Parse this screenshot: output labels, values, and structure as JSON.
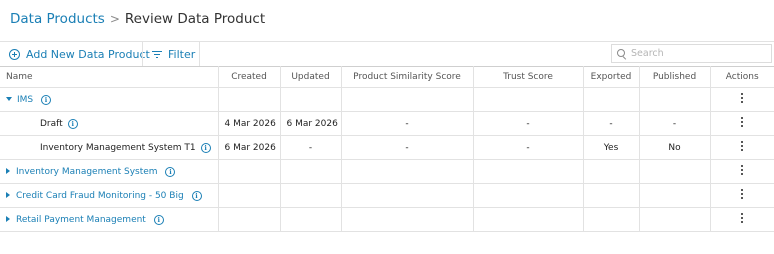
{
  "breadcrumb": {
    "parent": "Data Products",
    "separator": ">",
    "current": "Review Data Product"
  },
  "toolbar": {
    "add_label": "Add New Data Product",
    "filter_label": "Filter",
    "search_placeholder": "Search",
    "search_value": ""
  },
  "table": {
    "columns": [
      "Name",
      "Created",
      "Updated",
      "Product Similarity Score",
      "Trust Score",
      "Exported",
      "Published",
      "Actions"
    ],
    "rows": [
      {
        "type": "group",
        "expanded": true,
        "name": "IMS",
        "created": "",
        "updated": "",
        "similarity": "",
        "trust": "",
        "exported": "",
        "published": ""
      },
      {
        "type": "child",
        "name": "Draft",
        "created": "4 Mar 2026",
        "updated": "6 Mar 2026",
        "similarity": "-",
        "trust": "-",
        "exported": "-",
        "published": "-"
      },
      {
        "type": "child",
        "name": "Inventory Management System T1",
        "created": "6 Mar 2026",
        "updated": "-",
        "similarity": "-",
        "trust": "-",
        "exported": "Yes",
        "published": "No"
      },
      {
        "type": "group",
        "expanded": false,
        "name": "Inventory Management System",
        "created": "",
        "updated": "",
        "similarity": "",
        "trust": "",
        "exported": "",
        "published": ""
      },
      {
        "type": "group",
        "expanded": false,
        "name": "Credit Card Fraud Monitoring - 50 Big",
        "created": "",
        "updated": "",
        "similarity": "",
        "trust": "",
        "exported": "",
        "published": ""
      },
      {
        "type": "group",
        "expanded": false,
        "name": "Retail Payment Management",
        "created": "",
        "updated": "",
        "similarity": "",
        "trust": "",
        "exported": "",
        "published": ""
      }
    ]
  },
  "icons": {
    "add": "plus-circle-icon",
    "filter": "filter-icon",
    "search": "search-icon",
    "info": "info-icon",
    "actions": "kebab-menu-icon",
    "expanded": "caret-down-icon",
    "collapsed": "caret-right-icon"
  },
  "colors": {
    "link": "#1a7fb5",
    "border": "#e2e2e2",
    "text": "#222222"
  }
}
